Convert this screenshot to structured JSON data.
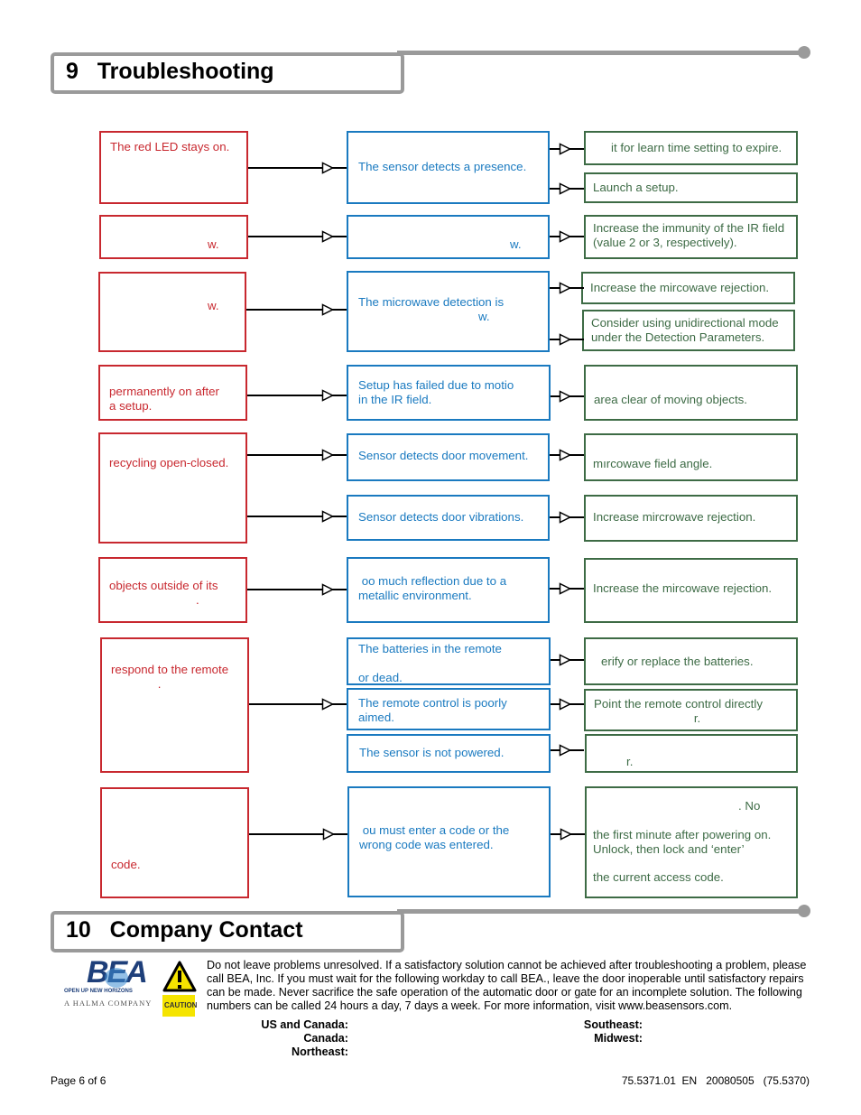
{
  "section9": {
    "number": "9",
    "title": "Troubleshooting"
  },
  "section10": {
    "number": "10",
    "title": "Company Contact"
  },
  "troubleshooting": {
    "rows": [
      {
        "problem": "The red LED stays on.",
        "causes": [
          "The sensor detects a presence."
        ],
        "solutions": [
          "it for learn time setting to expire.",
          "Launch a setup."
        ]
      },
      {
        "problem": "w.",
        "causes": [
          "w."
        ],
        "solutions": [
          "Increase the immunity of the IR field\n(value 2 or 3, respectively)."
        ]
      },
      {
        "problem": "w.",
        "causes": [
          "The microwave detection is\n                                    w."
        ],
        "solutions": [
          "Increase the mircowave rejection.",
          "Consider using unidirectional mode\nunder the Detection Parameters."
        ]
      },
      {
        "problem": "permanently on after\na setup.",
        "causes": [
          "Setup has failed due to motio\nin the IR field."
        ],
        "solutions": [
          "area clear of moving objects."
        ]
      },
      {
        "problem": "recycling open-closed.",
        "causes": [
          "Sensor detects door movement.",
          "Sensor detects door vibrations."
        ],
        "solutions": [
          "mırcowave field angle.",
          "Increase mircrowave rejection."
        ]
      },
      {
        "problem": "objects outside of its\n                          .",
        "causes": [
          " oo much reflection due to a\nmetallic environment."
        ],
        "solutions": [
          "Increase the mircowave rejection."
        ]
      },
      {
        "problem": "respond to the remote\n              .",
        "causes": [
          "The batteries in the remote\n\nor dead.",
          "The remote control is poorly\naimed.",
          "The sensor is not powered."
        ],
        "solutions": [
          "erify or replace the batteries.",
          "Point the remote control directly\n                              r.",
          "r."
        ]
      },
      {
        "problem": "code.",
        "causes": [
          " ou must enter a code or the\nwrong code was entered."
        ],
        "solutions": [
          ". No",
          "the first minute after powering on.\nUnlock, then lock and ‘enter’",
          "the current access code."
        ]
      }
    ]
  },
  "contact": {
    "logo": {
      "brand": "BEA",
      "tagline": "OPEN UP NEW HORIZONS",
      "parent": "A HALMA COMPANY"
    },
    "caution_label": "CAUTION",
    "caution_icon": "warning-triangle-icon",
    "paragraph": "Do not leave problems unresolved. If a satisfactory solution cannot be achieved after troubleshooting a problem, please call BEA, Inc.  If you must wait for the following workday to call BEA., leave the door inoperable until satisfactory repairs can be made.   Never sacrifice the safe operation of the automatic door or gate for an incomplete solution. The following numbers can be called 24 hours a day, 7 days a week.  For more information, visit www.beasensors.com.",
    "regions_left": [
      "US and Canada:",
      "Canada:",
      "Northeast:"
    ],
    "regions_right": [
      "Southeast:",
      "Midwest:"
    ]
  },
  "footer": {
    "page": "Page 6 of 6",
    "doc_ref": "75.5371.01  EN   20080505   (75.5370)"
  },
  "colors": {
    "problem": "#c8282f",
    "cause": "#1a7ac0",
    "solution": "#3d6b45",
    "rule": "#9a9a9a"
  }
}
